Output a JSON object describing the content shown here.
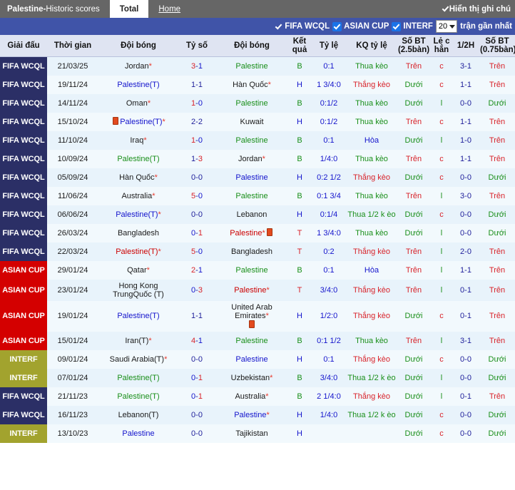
{
  "header": {
    "title_main": "Palestine",
    "title_sep": " - ",
    "title_sub": "Historic scores",
    "tab_total": "Total",
    "tab_home": "Home",
    "show_notes_label": "Hiển thị ghi chú"
  },
  "filters": {
    "fifa_wcql": "FIFA WCQL",
    "asian_cup": "ASIAN CUP",
    "interf": "INTERF",
    "count_value": "20",
    "count_suffix": "trận gần nhất"
  },
  "columns": [
    "Giải đấu",
    "Thời gian",
    "Đội bóng",
    "Tỷ số",
    "Đội bóng",
    "Kết quả",
    "Tỷ lệ",
    "KQ tỷ lệ",
    "Số BT (2.5bàn)",
    "Lẻ c hẳn",
    "1/2H",
    "Số BT (0.75bàn)"
  ],
  "rows": [
    {
      "league": "FIFA WCQL",
      "league_cls": "lg-wcq",
      "date": "21/03/25",
      "home": "Jordan",
      "home_star": true,
      "home_cls": "c-black",
      "home_card": false,
      "home_card_after": false,
      "score": "3-1",
      "score_h_cls": "c-red",
      "score_a_cls": "c-blue",
      "away": "Palestine",
      "away_star": false,
      "away_cls": "c-green",
      "away_card": false,
      "result": "B",
      "result_cls": "c-green",
      "odds": "0:1",
      "odds_cls": "c-blue",
      "kq": "Thua kèo",
      "kq_cls": "c-green",
      "bt25": "Trên",
      "bt25_cls": "c-red",
      "oddeven": "c",
      "oddeven_cls": "c-red",
      "half": "3-1",
      "half_cls": "c-navy",
      "bt075": "Trên",
      "bt075_cls": "c-red"
    },
    {
      "league": "FIFA WCQL",
      "league_cls": "lg-wcq",
      "date": "19/11/24",
      "home": "Palestine(T)",
      "home_star": false,
      "home_cls": "c-blue",
      "home_card": false,
      "score": "1-1",
      "score_h_cls": "c-navy",
      "score_a_cls": "c-navy",
      "away": "Hàn Quốc",
      "away_star": true,
      "away_cls": "c-black",
      "away_card": false,
      "result": "H",
      "result_cls": "c-blue",
      "odds": "1 3/4:0",
      "odds_cls": "c-blue",
      "kq": "Thắng kèo",
      "kq_cls": "c-red",
      "bt25": "Dưới",
      "bt25_cls": "c-green",
      "oddeven": "c",
      "oddeven_cls": "c-red",
      "half": "1-1",
      "half_cls": "c-navy",
      "bt075": "Trên",
      "bt075_cls": "c-red"
    },
    {
      "league": "FIFA WCQL",
      "league_cls": "lg-wcq",
      "date": "14/11/24",
      "home": "Oman",
      "home_star": true,
      "home_cls": "c-black",
      "home_card": false,
      "score": "1-0",
      "score_h_cls": "c-red",
      "score_a_cls": "c-blue",
      "away": "Palestine",
      "away_star": false,
      "away_cls": "c-green",
      "away_card": false,
      "result": "B",
      "result_cls": "c-green",
      "odds": "0:1/2",
      "odds_cls": "c-blue",
      "kq": "Thua kèo",
      "kq_cls": "c-green",
      "bt25": "Dưới",
      "bt25_cls": "c-green",
      "oddeven": "l",
      "oddeven_cls": "c-green",
      "half": "0-0",
      "half_cls": "c-navy",
      "bt075": "Dưới",
      "bt075_cls": "c-green"
    },
    {
      "league": "FIFA WCQL",
      "league_cls": "lg-wcq",
      "date": "15/10/24",
      "home": "Palestine(T)",
      "home_star": true,
      "home_cls": "c-blue",
      "home_card": true,
      "home_card_before": true,
      "score": "2-2",
      "score_h_cls": "c-navy",
      "score_a_cls": "c-navy",
      "away": "Kuwait",
      "away_star": false,
      "away_cls": "c-black",
      "away_card": false,
      "result": "H",
      "result_cls": "c-blue",
      "odds": "0:1/2",
      "odds_cls": "c-blue",
      "kq": "Thua kèo",
      "kq_cls": "c-green",
      "bt25": "Trên",
      "bt25_cls": "c-red",
      "oddeven": "c",
      "oddeven_cls": "c-red",
      "half": "1-1",
      "half_cls": "c-navy",
      "bt075": "Trên",
      "bt075_cls": "c-red"
    },
    {
      "league": "FIFA WCQL",
      "league_cls": "lg-wcq",
      "date": "11/10/24",
      "home": "Iraq",
      "home_star": true,
      "home_cls": "c-black",
      "home_card": false,
      "score": "1-0",
      "score_h_cls": "c-red",
      "score_a_cls": "c-blue",
      "away": "Palestine",
      "away_star": false,
      "away_cls": "c-green",
      "away_card": false,
      "result": "B",
      "result_cls": "c-green",
      "odds": "0:1",
      "odds_cls": "c-blue",
      "kq": "Hòa",
      "kq_cls": "c-blue",
      "bt25": "Dưới",
      "bt25_cls": "c-green",
      "oddeven": "l",
      "oddeven_cls": "c-green",
      "half": "1-0",
      "half_cls": "c-navy",
      "bt075": "Trên",
      "bt075_cls": "c-red"
    },
    {
      "league": "FIFA WCQL",
      "league_cls": "lg-wcq",
      "date": "10/09/24",
      "home": "Palestine(T)",
      "home_star": false,
      "home_cls": "c-green",
      "home_card": false,
      "score": "1-3",
      "score_h_cls": "c-navy",
      "score_a_cls": "c-red",
      "away": "Jordan",
      "away_star": true,
      "away_cls": "c-black",
      "away_card": false,
      "result": "B",
      "result_cls": "c-green",
      "odds": "1/4:0",
      "odds_cls": "c-blue",
      "kq": "Thua kèo",
      "kq_cls": "c-green",
      "bt25": "Trên",
      "bt25_cls": "c-red",
      "oddeven": "c",
      "oddeven_cls": "c-red",
      "half": "1-1",
      "half_cls": "c-navy",
      "bt075": "Trên",
      "bt075_cls": "c-red"
    },
    {
      "league": "FIFA WCQL",
      "league_cls": "lg-wcq",
      "date": "05/09/24",
      "home": "Hàn Quốc",
      "home_star": true,
      "home_cls": "c-black",
      "home_card": false,
      "score": "0-0",
      "score_h_cls": "c-navy",
      "score_a_cls": "c-navy",
      "away": "Palestine",
      "away_star": false,
      "away_cls": "c-blue",
      "away_card": false,
      "result": "H",
      "result_cls": "c-blue",
      "odds": "0:2 1/2",
      "odds_cls": "c-blue",
      "kq": "Thắng kèo",
      "kq_cls": "c-red",
      "bt25": "Dưới",
      "bt25_cls": "c-green",
      "oddeven": "c",
      "oddeven_cls": "c-red",
      "half": "0-0",
      "half_cls": "c-navy",
      "bt075": "Dưới",
      "bt075_cls": "c-green"
    },
    {
      "league": "FIFA WCQL",
      "league_cls": "lg-wcq",
      "date": "11/06/24",
      "home": "Australia",
      "home_star": true,
      "home_cls": "c-black",
      "home_card": false,
      "score": "5-0",
      "score_h_cls": "c-red",
      "score_a_cls": "c-blue",
      "away": "Palestine",
      "away_star": false,
      "away_cls": "c-green",
      "away_card": false,
      "result": "B",
      "result_cls": "c-green",
      "odds": "0:1 3/4",
      "odds_cls": "c-blue",
      "kq": "Thua kèo",
      "kq_cls": "c-green",
      "bt25": "Trên",
      "bt25_cls": "c-red",
      "oddeven": "l",
      "oddeven_cls": "c-green",
      "half": "3-0",
      "half_cls": "c-navy",
      "bt075": "Trên",
      "bt075_cls": "c-red"
    },
    {
      "league": "FIFA WCQL",
      "league_cls": "lg-wcq",
      "date": "06/06/24",
      "home": "Palestine(T)",
      "home_star": true,
      "home_cls": "c-blue",
      "home_card": false,
      "score": "0-0",
      "score_h_cls": "c-navy",
      "score_a_cls": "c-navy",
      "away": "Lebanon",
      "away_star": false,
      "away_cls": "c-black",
      "away_card": false,
      "result": "H",
      "result_cls": "c-blue",
      "odds": "0:1/4",
      "odds_cls": "c-blue",
      "kq": "Thua 1/2 k èo",
      "kq_cls": "c-green",
      "bt25": "Dưới",
      "bt25_cls": "c-green",
      "oddeven": "c",
      "oddeven_cls": "c-red",
      "half": "0-0",
      "half_cls": "c-navy",
      "bt075": "Dưới",
      "bt075_cls": "c-green"
    },
    {
      "league": "FIFA WCQL",
      "league_cls": "lg-wcq",
      "date": "26/03/24",
      "home": "Bangladesh",
      "home_star": false,
      "home_cls": "c-black",
      "home_card": false,
      "score": "0-1",
      "score_h_cls": "c-blue",
      "score_a_cls": "c-red",
      "away": "Palestine",
      "away_star": true,
      "away_cls": "c-dkred",
      "away_card": true,
      "result": "T",
      "result_cls": "c-red",
      "odds": "1 3/4:0",
      "odds_cls": "c-blue",
      "kq": "Thua kèo",
      "kq_cls": "c-green",
      "bt25": "Dưới",
      "bt25_cls": "c-green",
      "oddeven": "l",
      "oddeven_cls": "c-green",
      "half": "0-0",
      "half_cls": "c-navy",
      "bt075": "Dưới",
      "bt075_cls": "c-green"
    },
    {
      "league": "FIFA WCQL",
      "league_cls": "lg-wcq",
      "date": "22/03/24",
      "home": "Palestine(T)",
      "home_star": true,
      "home_cls": "c-dkred",
      "home_card": false,
      "score": "5-0",
      "score_h_cls": "c-red",
      "score_a_cls": "c-blue",
      "away": "Bangladesh",
      "away_star": false,
      "away_cls": "c-black",
      "away_card": false,
      "result": "T",
      "result_cls": "c-red",
      "odds": "0:2",
      "odds_cls": "c-blue",
      "kq": "Thắng kèo",
      "kq_cls": "c-red",
      "bt25": "Trên",
      "bt25_cls": "c-red",
      "oddeven": "l",
      "oddeven_cls": "c-green",
      "half": "2-0",
      "half_cls": "c-navy",
      "bt075": "Trên",
      "bt075_cls": "c-red"
    },
    {
      "league": "ASIAN CUP",
      "league_cls": "lg-asia",
      "date": "29/01/24",
      "home": "Qatar",
      "home_star": true,
      "home_cls": "c-black",
      "home_card": false,
      "score": "2-1",
      "score_h_cls": "c-red",
      "score_a_cls": "c-blue",
      "away": "Palestine",
      "away_star": false,
      "away_cls": "c-green",
      "away_card": false,
      "result": "B",
      "result_cls": "c-green",
      "odds": "0:1",
      "odds_cls": "c-blue",
      "kq": "Hòa",
      "kq_cls": "c-blue",
      "bt25": "Trên",
      "bt25_cls": "c-red",
      "oddeven": "l",
      "oddeven_cls": "c-green",
      "half": "1-1",
      "half_cls": "c-navy",
      "bt075": "Trên",
      "bt075_cls": "c-red"
    },
    {
      "league": "ASIAN CUP",
      "league_cls": "lg-asia",
      "date": "23/01/24",
      "home": "Hong Kong TrungQuốc (T)",
      "home_star": false,
      "home_cls": "c-black",
      "home_card": false,
      "score": "0-3",
      "score_h_cls": "c-blue",
      "score_a_cls": "c-red",
      "away": "Palestine",
      "away_star": true,
      "away_cls": "c-dkred",
      "away_card": false,
      "result": "T",
      "result_cls": "c-red",
      "odds": "3/4:0",
      "odds_cls": "c-blue",
      "kq": "Thắng kèo",
      "kq_cls": "c-red",
      "bt25": "Trên",
      "bt25_cls": "c-red",
      "oddeven": "l",
      "oddeven_cls": "c-green",
      "half": "0-1",
      "half_cls": "c-navy",
      "bt075": "Trên",
      "bt075_cls": "c-red"
    },
    {
      "league": "ASIAN CUP",
      "league_cls": "lg-asia",
      "date": "19/01/24",
      "home": "Palestine(T)",
      "home_star": false,
      "home_cls": "c-blue",
      "home_card": false,
      "score": "1-1",
      "score_h_cls": "c-navy",
      "score_a_cls": "c-navy",
      "away": "United Arab Emirates",
      "away_star": true,
      "away_cls": "c-black",
      "away_card": true,
      "away_card_below": true,
      "result": "H",
      "result_cls": "c-blue",
      "odds": "1/2:0",
      "odds_cls": "c-blue",
      "kq": "Thắng kèo",
      "kq_cls": "c-red",
      "bt25": "Dưới",
      "bt25_cls": "c-green",
      "oddeven": "c",
      "oddeven_cls": "c-red",
      "half": "0-1",
      "half_cls": "c-navy",
      "bt075": "Trên",
      "bt075_cls": "c-red"
    },
    {
      "league": "ASIAN CUP",
      "league_cls": "lg-asia",
      "date": "15/01/24",
      "home": "Iran(T)",
      "home_star": true,
      "home_cls": "c-black",
      "home_card": false,
      "score": "4-1",
      "score_h_cls": "c-red",
      "score_a_cls": "c-blue",
      "away": "Palestine",
      "away_star": false,
      "away_cls": "c-green",
      "away_card": false,
      "result": "B",
      "result_cls": "c-green",
      "odds": "0:1 1/2",
      "odds_cls": "c-blue",
      "kq": "Thua kèo",
      "kq_cls": "c-green",
      "bt25": "Trên",
      "bt25_cls": "c-red",
      "oddeven": "l",
      "oddeven_cls": "c-green",
      "half": "3-1",
      "half_cls": "c-navy",
      "bt075": "Trên",
      "bt075_cls": "c-red"
    },
    {
      "league": "INTERF",
      "league_cls": "lg-intf",
      "date": "09/01/24",
      "home": "Saudi Arabia(T)",
      "home_star": true,
      "home_cls": "c-black",
      "home_card": false,
      "score": "0-0",
      "score_h_cls": "c-navy",
      "score_a_cls": "c-navy",
      "away": "Palestine",
      "away_star": false,
      "away_cls": "c-blue",
      "away_card": false,
      "result": "H",
      "result_cls": "c-blue",
      "odds": "0:1",
      "odds_cls": "c-blue",
      "kq": "Thắng kèo",
      "kq_cls": "c-red",
      "bt25": "Dưới",
      "bt25_cls": "c-green",
      "oddeven": "c",
      "oddeven_cls": "c-red",
      "half": "0-0",
      "half_cls": "c-navy",
      "bt075": "Dưới",
      "bt075_cls": "c-green"
    },
    {
      "league": "INTERF",
      "league_cls": "lg-intf",
      "date": "07/01/24",
      "home": "Palestine(T)",
      "home_star": false,
      "home_cls": "c-green",
      "home_card": false,
      "score": "0-1",
      "score_h_cls": "c-blue",
      "score_a_cls": "c-red",
      "away": "Uzbekistan",
      "away_star": true,
      "away_cls": "c-black",
      "away_card": false,
      "result": "B",
      "result_cls": "c-green",
      "odds": "3/4:0",
      "odds_cls": "c-blue",
      "kq": "Thua 1/2 k èo",
      "kq_cls": "c-green",
      "bt25": "Dưới",
      "bt25_cls": "c-green",
      "oddeven": "l",
      "oddeven_cls": "c-green",
      "half": "0-0",
      "half_cls": "c-navy",
      "bt075": "Dưới",
      "bt075_cls": "c-green"
    },
    {
      "league": "FIFA WCQL",
      "league_cls": "lg-wcq",
      "date": "21/11/23",
      "home": "Palestine(T)",
      "home_star": false,
      "home_cls": "c-green",
      "home_card": false,
      "score": "0-1",
      "score_h_cls": "c-blue",
      "score_a_cls": "c-red",
      "away": "Australia",
      "away_star": true,
      "away_cls": "c-black",
      "away_card": false,
      "result": "B",
      "result_cls": "c-green",
      "odds": "2 1/4:0",
      "odds_cls": "c-blue",
      "kq": "Thắng kèo",
      "kq_cls": "c-red",
      "bt25": "Dưới",
      "bt25_cls": "c-green",
      "oddeven": "l",
      "oddeven_cls": "c-green",
      "half": "0-1",
      "half_cls": "c-navy",
      "bt075": "Trên",
      "bt075_cls": "c-red"
    },
    {
      "league": "FIFA WCQL",
      "league_cls": "lg-wcq",
      "date": "16/11/23",
      "home": "Lebanon(T)",
      "home_star": false,
      "home_cls": "c-black",
      "home_card": false,
      "score": "0-0",
      "score_h_cls": "c-navy",
      "score_a_cls": "c-navy",
      "away": "Palestine",
      "away_star": true,
      "away_cls": "c-blue",
      "away_card": false,
      "result": "H",
      "result_cls": "c-blue",
      "odds": "1/4:0",
      "odds_cls": "c-blue",
      "kq": "Thua 1/2 k èo",
      "kq_cls": "c-green",
      "bt25": "Dưới",
      "bt25_cls": "c-green",
      "oddeven": "c",
      "oddeven_cls": "c-red",
      "half": "0-0",
      "half_cls": "c-navy",
      "bt075": "Dưới",
      "bt075_cls": "c-green"
    },
    {
      "league": "INTERF",
      "league_cls": "lg-intf",
      "date": "13/10/23",
      "home": "Palestine",
      "home_star": false,
      "home_cls": "c-blue",
      "home_card": false,
      "score": "0-0",
      "score_h_cls": "c-navy",
      "score_a_cls": "c-navy",
      "away": "Tajikistan",
      "away_star": false,
      "away_cls": "c-black",
      "away_card": false,
      "result": "H",
      "result_cls": "c-blue",
      "odds": "",
      "odds_cls": "c-blue",
      "kq": "",
      "kq_cls": "c-green",
      "bt25": "Dưới",
      "bt25_cls": "c-green",
      "oddeven": "c",
      "oddeven_cls": "c-red",
      "half": "0-0",
      "half_cls": "c-navy",
      "bt075": "Dưới",
      "bt075_cls": "c-green"
    }
  ]
}
